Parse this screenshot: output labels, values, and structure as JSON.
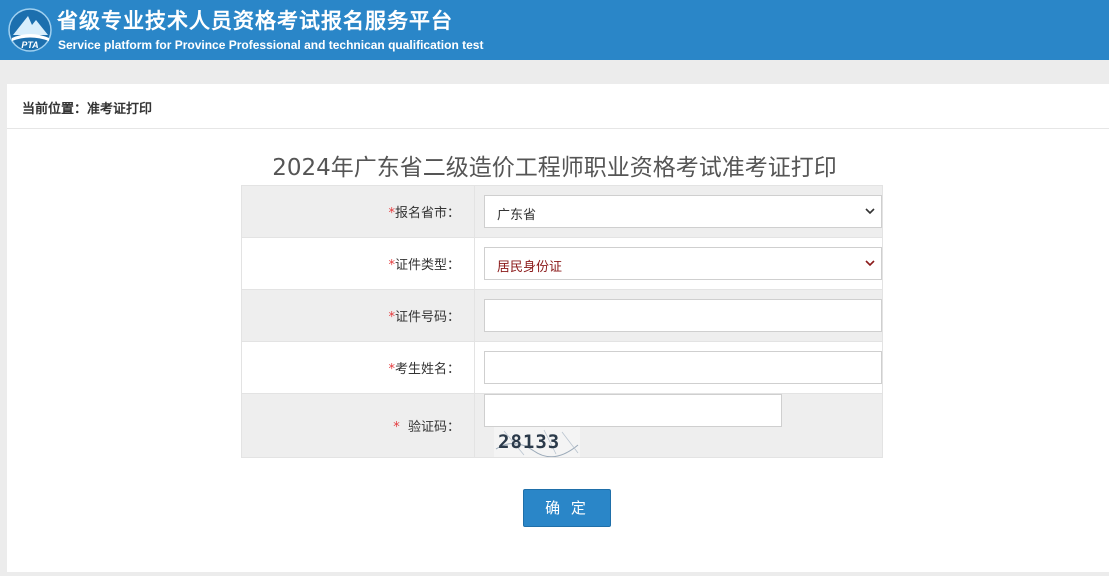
{
  "header": {
    "title": "省级专业技术人员资格考试报名服务平台",
    "subtitle": "Service platform for Province Professional and technican qualification test",
    "logo_text": "PTA",
    "bg_color": "#2a86c8"
  },
  "breadcrumb": {
    "text": "当前位置：准考证打印"
  },
  "page_title": "2024年广东省二级造价工程师职业资格考试准考证打印",
  "form": {
    "required_mark": "*",
    "province": {
      "label": "报名省市：",
      "value": "广东省"
    },
    "id_type": {
      "label": "证件类型：",
      "value": "居民身份证"
    },
    "id_number": {
      "label": "证件号码：",
      "value": ""
    },
    "name": {
      "label": "考生姓名：",
      "value": ""
    },
    "captcha": {
      "label": "验证码：",
      "required_mark": "* ",
      "value": "",
      "image_text": "28133"
    }
  },
  "submit_label": "确 定"
}
